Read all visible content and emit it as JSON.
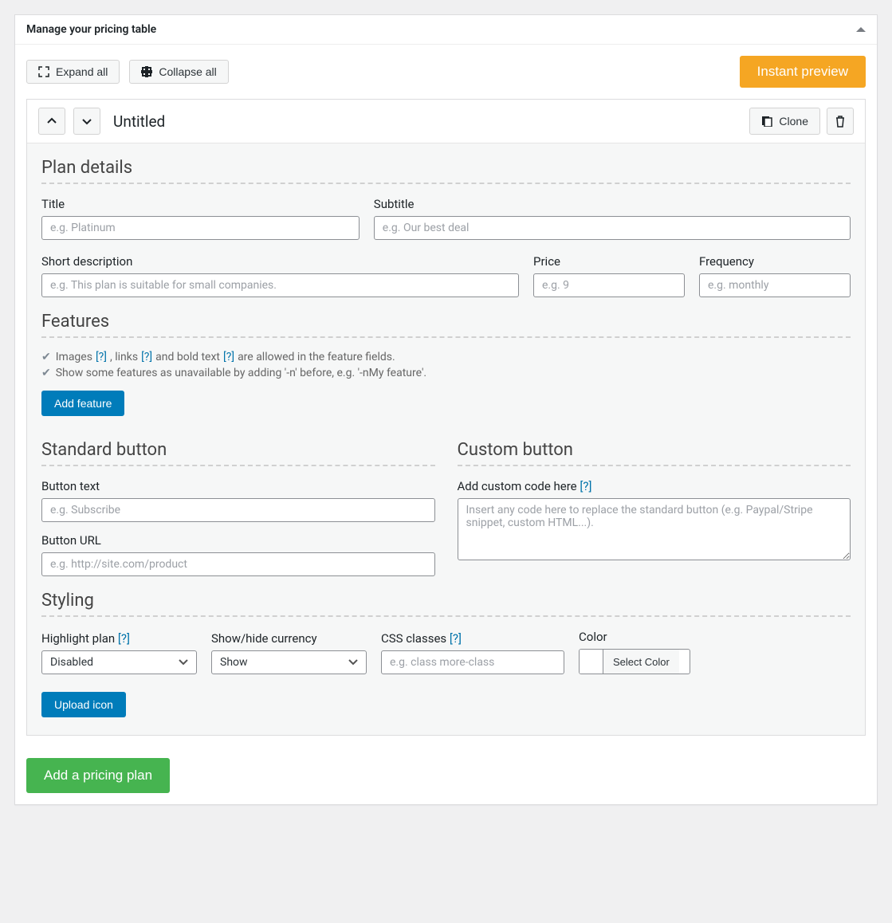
{
  "header": {
    "title": "Manage your pricing table"
  },
  "toolbar": {
    "expand_all": "Expand all",
    "collapse_all": "Collapse all",
    "instant_preview": "Instant preview"
  },
  "plan": {
    "title": "Untitled",
    "clone_label": "Clone"
  },
  "sections": {
    "plan_details": "Plan details",
    "features": "Features",
    "standard_button": "Standard button",
    "custom_button": "Custom button",
    "styling": "Styling"
  },
  "fields": {
    "title_label": "Title",
    "title_placeholder": "e.g. Platinum",
    "subtitle_label": "Subtitle",
    "subtitle_placeholder": "e.g. Our best deal",
    "short_desc_label": "Short description",
    "short_desc_placeholder": "e.g. This plan is suitable for small companies.",
    "price_label": "Price",
    "price_placeholder": "e.g. 9",
    "frequency_label": "Frequency",
    "frequency_placeholder": "e.g. monthly",
    "button_text_label": "Button text",
    "button_text_placeholder": "e.g. Subscribe",
    "button_url_label": "Button URL",
    "button_url_placeholder": "e.g. http://site.com/product",
    "custom_code_label": "Add custom code here",
    "custom_code_placeholder": "Insert any code here to replace the standard button (e.g. Paypal/Stripe snippet, custom HTML...).",
    "highlight_label": "Highlight plan",
    "highlight_value": "Disabled",
    "showhide_label": "Show/hide currency",
    "showhide_value": "Show",
    "css_label": "CSS classes",
    "css_placeholder": "e.g. class more-class",
    "color_label": "Color",
    "color_btn": "Select Color"
  },
  "feature_tips": {
    "tip1_a": "Images ",
    "tip1_b": ", links ",
    "tip1_c": " and bold text ",
    "tip1_d": " are allowed in the feature fields.",
    "tip2": "Show some features as unavailable by adding '-n' before, e.g. '-nMy feature'.",
    "help": "[?]"
  },
  "buttons": {
    "add_feature": "Add feature",
    "upload_icon": "Upload icon",
    "add_pricing_plan": "Add a pricing plan"
  }
}
